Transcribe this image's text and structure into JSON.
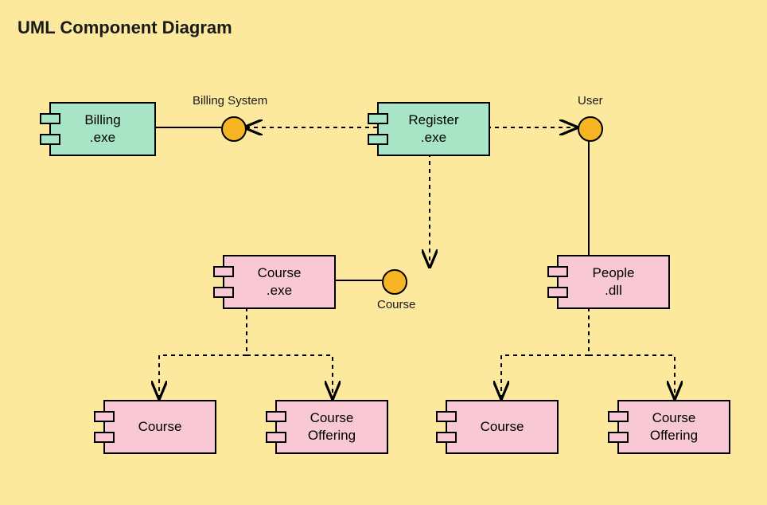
{
  "title": "UML Component Diagram",
  "interfaces": {
    "billing": "Billing System",
    "user": "User",
    "course": "Course"
  },
  "components": {
    "billing_exe": {
      "l1": "Billing",
      "l2": ".exe"
    },
    "register_exe": {
      "l1": "Register",
      "l2": ".exe"
    },
    "course_exe": {
      "l1": "Course",
      "l2": ".exe"
    },
    "people_dll": {
      "l1": "People",
      "l2": ".dll"
    },
    "course_bl": {
      "l1": "Course"
    },
    "course_off_bl": {
      "l1": "Course",
      "l2": "Offering"
    },
    "course_br": {
      "l1": "Course"
    },
    "course_off_br": {
      "l1": "Course",
      "l2": "Offering"
    }
  },
  "colors": {
    "bg": "#fce99e",
    "green": "#a8e4c6",
    "pink": "#f8c9d4",
    "ball": "#f6b623"
  }
}
